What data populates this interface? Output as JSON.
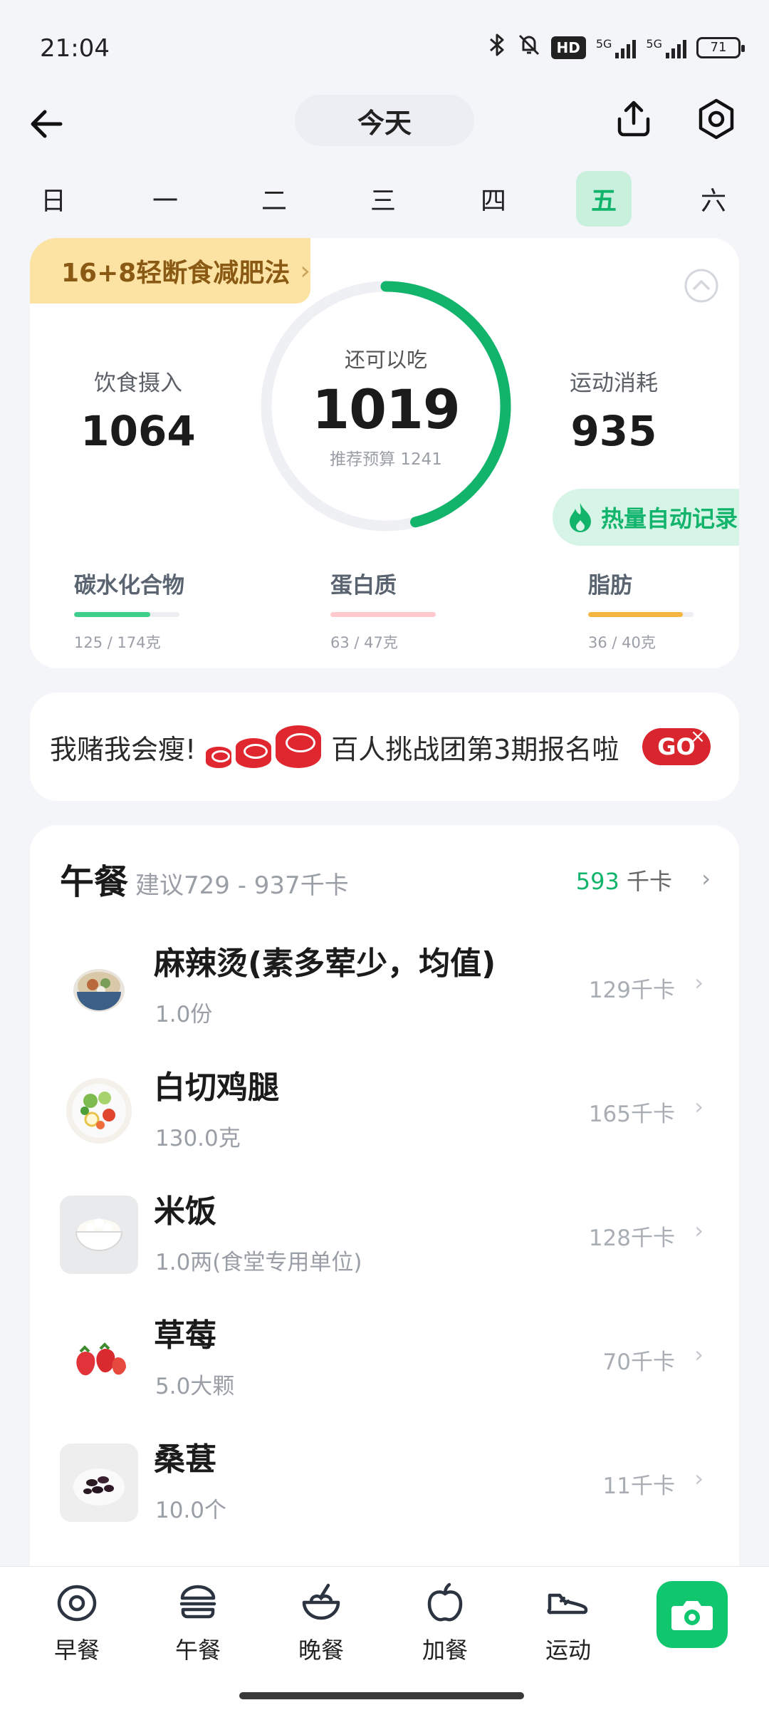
{
  "status_bar": {
    "time": "21:04",
    "hd_label": "HD",
    "signal1_label": "5G",
    "signal2_label": "5G",
    "battery": "71",
    "icons": [
      "bluetooth-icon",
      "mute-icon"
    ]
  },
  "header": {
    "date_label": "今天",
    "icons": [
      "back-arrow-icon",
      "share-icon",
      "settings-icon"
    ]
  },
  "weekdays": {
    "days": [
      "日",
      "一",
      "二",
      "三",
      "四",
      "五",
      "六"
    ],
    "active_index": 5
  },
  "summary": {
    "fasting_tag": "16+8轻断食减肥法",
    "intake_label": "饮食摄入",
    "intake_value": "1064",
    "remaining_label": "还可以吃",
    "remaining_value": "1019",
    "budget_text": "推荐预算 1241",
    "burn_label": "运动消耗",
    "burn_value": "935",
    "auto_record_label": "热量自动记录",
    "ring_progress": 0.46,
    "colors": {
      "accent": "#12b46c",
      "ring_track": "#eef0f4"
    },
    "macros": [
      {
        "name": "碳水化合物",
        "amount": "125 / 174克",
        "progress": 0.72,
        "color": "#3fcf8c"
      },
      {
        "name": "蛋白质",
        "amount": "63 / 47克",
        "progress": 1.0,
        "color": "#ffc9cd"
      },
      {
        "name": "脂肪",
        "amount": "36 / 40克",
        "progress": 0.9,
        "color": "#f4b640"
      }
    ]
  },
  "banner": {
    "left_text": "我赌我会瘦!",
    "right_text": "百人挑战团第3期报名啦",
    "go_label": "GO",
    "close_label": "×"
  },
  "meal": {
    "title": "午餐",
    "range": "建议729 - 937千卡",
    "total_value": "593",
    "total_unit": "千卡",
    "items": [
      {
        "name": "麻辣烫(素多荤少，均值)",
        "qty": "1.0份",
        "kcal": "129千卡",
        "icon": "malatang-bowl-icon"
      },
      {
        "name": "白切鸡腿",
        "qty": "130.0克",
        "kcal": "165千卡",
        "icon": "salad-plate-icon"
      },
      {
        "name": "米饭",
        "qty": "1.0两(食堂专用单位)",
        "kcal": "128千卡",
        "icon": "rice-bowl-icon"
      },
      {
        "name": "草莓",
        "qty": "5.0大颗",
        "kcal": "70千卡",
        "icon": "strawberry-icon"
      },
      {
        "name": "桑葚",
        "qty": "10.0个",
        "kcal": "11千卡",
        "icon": "mulberry-icon"
      }
    ]
  },
  "bottom_nav": {
    "items": [
      {
        "label": "早餐",
        "icon": "egg-icon"
      },
      {
        "label": "午餐",
        "icon": "burger-icon"
      },
      {
        "label": "晚餐",
        "icon": "bowl-icon"
      },
      {
        "label": "加餐",
        "icon": "apple-icon"
      },
      {
        "label": "运动",
        "icon": "sneaker-icon"
      }
    ],
    "camera_icon": "camera-icon"
  }
}
